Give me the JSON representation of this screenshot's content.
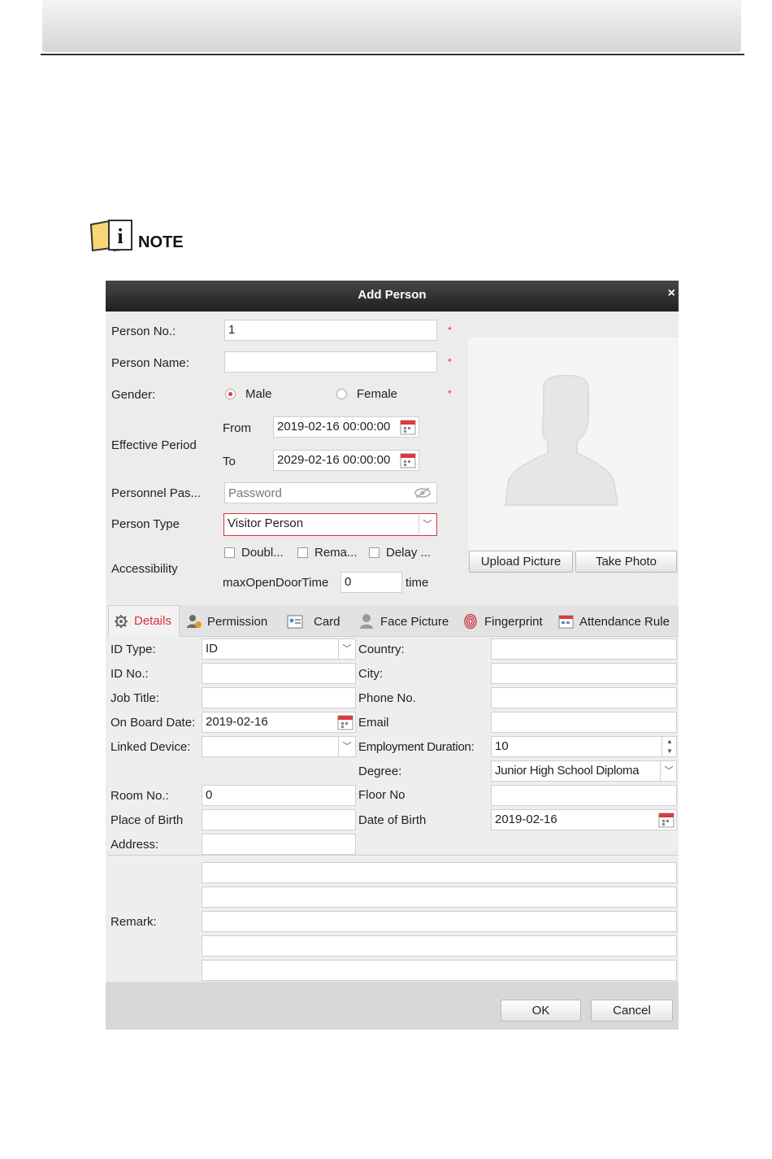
{
  "note": {
    "label": "NOTE"
  },
  "dialog": {
    "title": "Add Person",
    "close_glyph": "×",
    "person_no": {
      "label": "Person No.:",
      "value": "1"
    },
    "person_name": {
      "label": "Person Name:",
      "value": ""
    },
    "gender": {
      "label": "Gender:",
      "male": "Male",
      "female": "Female",
      "selected": "Male"
    },
    "effective_period": {
      "label": "Effective Period",
      "from_label": "From",
      "from_value": "2019-02-16 00:00:00",
      "to_label": "To",
      "to_value": "2029-02-16 00:00:00"
    },
    "password": {
      "label": "Personnel Pas...",
      "placeholder": "Password"
    },
    "person_type": {
      "label": "Person Type",
      "value": "Visitor Person"
    },
    "accessibility": {
      "label": "Accessibility",
      "options": [
        "Doubl...",
        "Rema...",
        "Delay ..."
      ],
      "max_open_label": "maxOpenDoorTime",
      "max_open_value": "0",
      "time_label": "time"
    },
    "required_mark": "*",
    "upload_picture": "Upload Picture",
    "take_photo": "Take Photo",
    "tabs": [
      "Details",
      "Permission",
      "Card",
      "Face Picture",
      "Fingerprint",
      "Attendance Rule"
    ],
    "active_tab": "Details",
    "details": {
      "id_type": {
        "label": "ID Type:",
        "value": "ID"
      },
      "id_no": {
        "label": "ID No.:",
        "value": ""
      },
      "job_title": {
        "label": "Job Title:",
        "value": ""
      },
      "on_board_date": {
        "label": "On Board Date:",
        "value": "2019-02-16"
      },
      "linked_device": {
        "label": "Linked Device:",
        "value": ""
      },
      "room_no": {
        "label": "Room No.:",
        "value": "0"
      },
      "place_of_birth": {
        "label": "Place of Birth",
        "value": ""
      },
      "address": {
        "label": "Address:",
        "value": ""
      },
      "country": {
        "label": "Country:",
        "value": ""
      },
      "city": {
        "label": "City:",
        "value": ""
      },
      "phone_no": {
        "label": "Phone No.",
        "value": ""
      },
      "email": {
        "label": "Email",
        "value": ""
      },
      "employment_duration": {
        "label": "Employment Duration:",
        "value": "10"
      },
      "degree": {
        "label": "Degree:",
        "value": "Junior High School Diploma"
      },
      "floor_no": {
        "label": "Floor No",
        "value": ""
      },
      "date_of_birth": {
        "label": "Date of Birth",
        "value": "2019-02-16"
      }
    },
    "remark": {
      "label": "Remark:"
    },
    "ok": "OK",
    "cancel": "Cancel"
  },
  "colors": {
    "accent": "#d8323c",
    "titlebar": "#2b2b2b",
    "dialog_bg": "#ececec"
  }
}
